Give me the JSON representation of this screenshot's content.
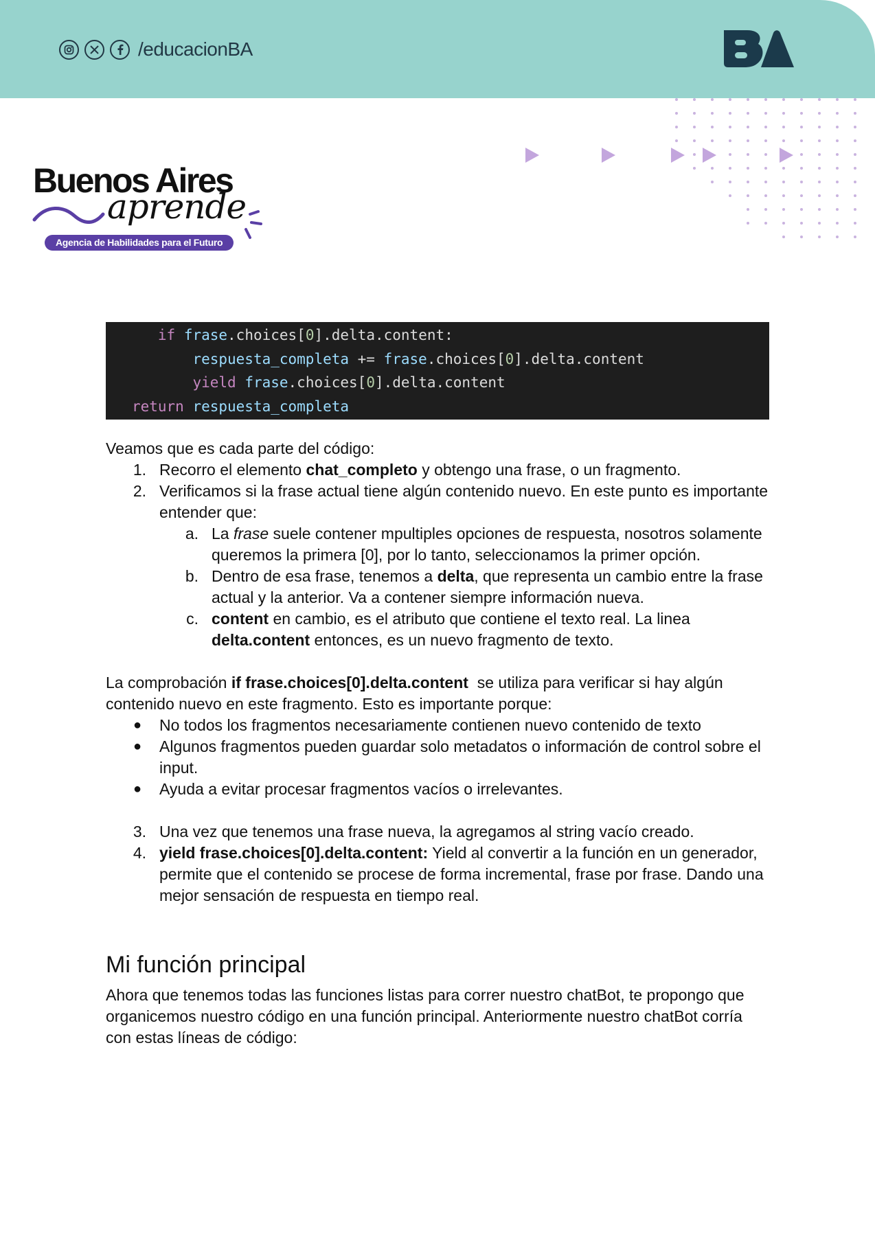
{
  "header": {
    "social_handle": "/educacionBA",
    "icons": [
      "instagram-icon",
      "x-icon",
      "facebook-icon"
    ],
    "logo_text": "BA",
    "band_color": "#97d3cd",
    "logo_color": "#1b3a4b"
  },
  "brand": {
    "name": "Buenos Aires",
    "script": "aprende",
    "tagline": "Agencia de Habilidades para el Futuro",
    "tag_color": "#5a3fa5"
  },
  "code": {
    "line1": {
      "indent": "      ",
      "kw": "if",
      "var": "frase",
      "p1": ".choices[",
      "n": "0",
      "p2": "].delta.content:"
    },
    "line2": {
      "indent": "          ",
      "var1": "respuesta_completa",
      "op": " += ",
      "var2": "frase",
      "p1": ".choices[",
      "n": "0",
      "p2": "].delta.content"
    },
    "line3": {
      "indent": "          ",
      "kw": "yield",
      "var": "frase",
      "p1": ".choices[",
      "n": "0",
      "p2": "].delta.content"
    },
    "line4": {
      "indent": "   ",
      "kw": "return",
      "var": "respuesta_completa"
    }
  },
  "body": {
    "intro": "Veamos que es cada parte del código:",
    "item1": {
      "marker": "1.",
      "pre": "Recorro el elemento ",
      "bold": "chat_completo",
      "post": " y obtengo una frase, o un fragmento."
    },
    "item2": {
      "marker": "2.",
      "text": "Verificamos si la frase actual tiene algún contenido nuevo. En este punto es importante entender que:"
    },
    "sub_a": {
      "marker": "a.",
      "pre": "La ",
      "em": "frase",
      "post": " suele contener mpultiples opciones de respuesta, nosotros solamente queremos la primera [0], por lo tanto, seleccionamos la primer opción."
    },
    "sub_b": {
      "marker": "b.",
      "pre": "Dentro de esa frase, tenemos a ",
      "bold": "delta",
      "post": ", que representa un cambio entre la frase actual y la anterior. Va a contener siempre información nueva."
    },
    "sub_c": {
      "marker": "c.",
      "bold1": "content",
      "mid": " en cambio, es el atributo que contiene el texto real. La linea ",
      "bold2": "delta.content",
      "post": " entonces, es un nuevo fragmento de texto."
    },
    "check": {
      "pre": "La comprobación ",
      "bold": "if frase.choices[0].delta.content",
      "post": "  se utiliza para verificar si hay algún contenido nuevo en este fragmento. Esto es importante porque:"
    },
    "bullets": [
      "No todos los fragmentos necesariamente contienen nuevo contenido de texto",
      "Algunos fragmentos pueden guardar solo metadatos o información de control sobre el input.",
      "Ayuda a evitar procesar fragmentos vacíos o irrelevantes."
    ],
    "bullet_marker": "●",
    "item3": {
      "marker": "3.",
      "text": "Una vez que tenemos una frase nueva, la agregamos al string vacío creado."
    },
    "item4": {
      "marker": "4.",
      "bold": "yield frase.choices[0].delta.content:",
      "post": " Yield al convertir a la función en un generador, permite que el contenido se procese de forma incremental, frase por frase. Dando una mejor sensación de respuesta en tiempo real."
    },
    "heading": "Mi función principal",
    "closing": "Ahora que tenemos todas las funciones listas para correr nuestro chatBot, te propongo que organicemos nuestro código en una función principal. Anteriormente nuestro chatBot corría con estas líneas de código:"
  }
}
